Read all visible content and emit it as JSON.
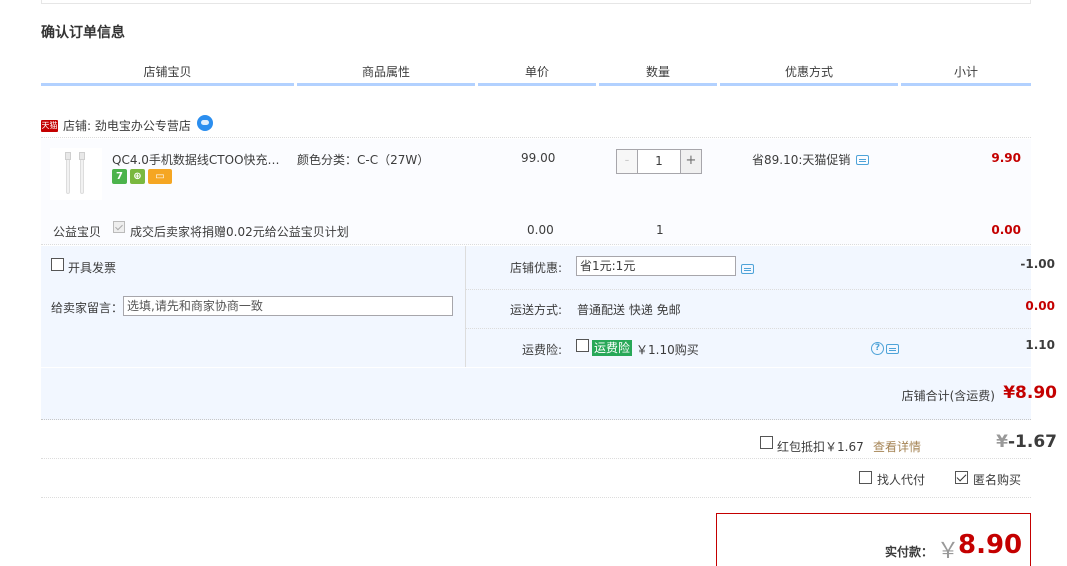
{
  "page": {
    "title": "确认订单信息"
  },
  "table_headers": [
    "店铺宝贝",
    "商品属性",
    "单价",
    "数量",
    "优惠方式",
    "小计"
  ],
  "store": {
    "badge": "天猫",
    "label": "店铺: 劲电宝办公专营店",
    "icon": "wangwang-chat-icon"
  },
  "item": {
    "title": "QC4.0手机数据线CTOO快充电…",
    "attr": "颜色分类：C-C（27W）",
    "price": "99.00",
    "quantity": "1",
    "qty_minus": "-",
    "qty_plus": "+",
    "promo": "省89.10:天猫促销",
    "subtotal": "9.90",
    "service_icons": [
      "7",
      "M",
      "card"
    ]
  },
  "charity": {
    "label": "公益宝贝",
    "text": "成交后卖家将捐赠0.02元给公益宝贝计划",
    "price": "0.00",
    "qty": "1",
    "subtotal": "0.00"
  },
  "invoice": {
    "label": "开具发票"
  },
  "message": {
    "label": "给卖家留言：",
    "placeholder": "选填,请先和商家协商一致"
  },
  "store_discount": {
    "label": "店铺优惠:",
    "value": "省1元:1元",
    "amount": "-1.00"
  },
  "shipping": {
    "label": "运送方式:",
    "value": "普通配送 快递 免邮",
    "amount": "0.00"
  },
  "insurance": {
    "label": "运费险:",
    "tag": "运费险",
    "text": "￥1.10购买",
    "amount": "1.10"
  },
  "store_total": {
    "label": "店铺合计(含运费)",
    "value": "¥8.90"
  },
  "redpack": {
    "label": "红包抵扣￥1.67",
    "detail": "查看详情",
    "yen": "¥",
    "value": "-1.67"
  },
  "options": {
    "proxy_pay": "找人代付",
    "anonymous": "匿名购买"
  },
  "payment": {
    "label": "实付款：",
    "yen": "￥",
    "value": "8.90"
  },
  "colors": {
    "accent_red": "#c40000",
    "header_line": "#b2d1ff",
    "panel_bg": "#f2f7ff",
    "insurance_green": "#28a858"
  }
}
